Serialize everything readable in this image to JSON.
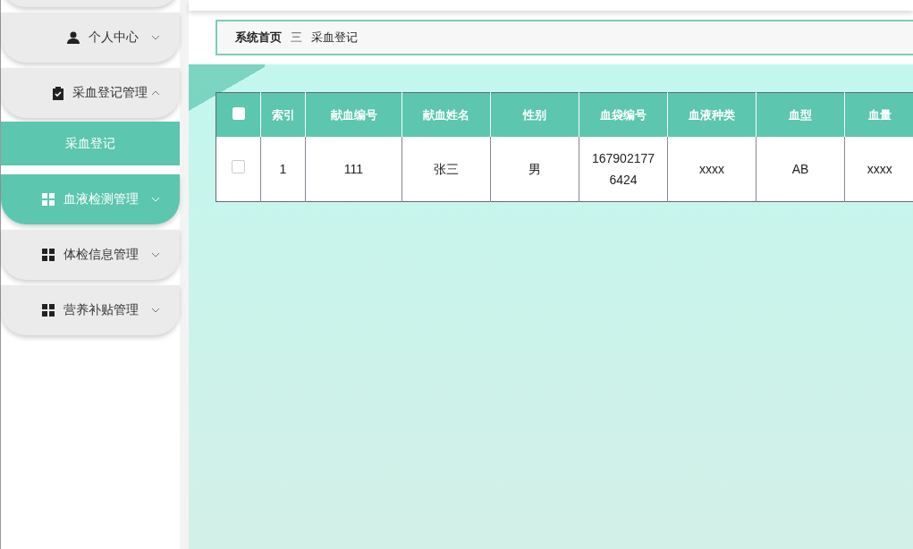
{
  "sidebar": {
    "items": [
      {
        "label": "个人中心",
        "kind": "person",
        "expanded": false,
        "hovered": false
      },
      {
        "label": "采血登记管理",
        "kind": "clipboard",
        "expanded": true,
        "hovered": false,
        "children": [
          {
            "label": "采血登记",
            "selected": true
          }
        ]
      },
      {
        "label": "血液检测管理",
        "kind": "grid",
        "expanded": false,
        "hovered": true
      },
      {
        "label": "体检信息管理",
        "kind": "grid",
        "expanded": false,
        "hovered": false
      },
      {
        "label": "营养补贴管理",
        "kind": "grid",
        "expanded": false,
        "hovered": false
      }
    ]
  },
  "breadcrumb": {
    "home": "系统首页",
    "separator": "三",
    "current": "采血登记"
  },
  "table": {
    "select_all": {
      "checked": false
    },
    "columns": [
      "索引",
      "献血编号",
      "献血姓名",
      "性别",
      "血袋编号",
      "血液种类",
      "血型",
      "血量"
    ],
    "rows": [
      {
        "checked": false,
        "cells": [
          "1",
          "111",
          "张三",
          "男",
          "1679021776424",
          "xxxx",
          "AB",
          "xxxx"
        ]
      }
    ]
  }
}
